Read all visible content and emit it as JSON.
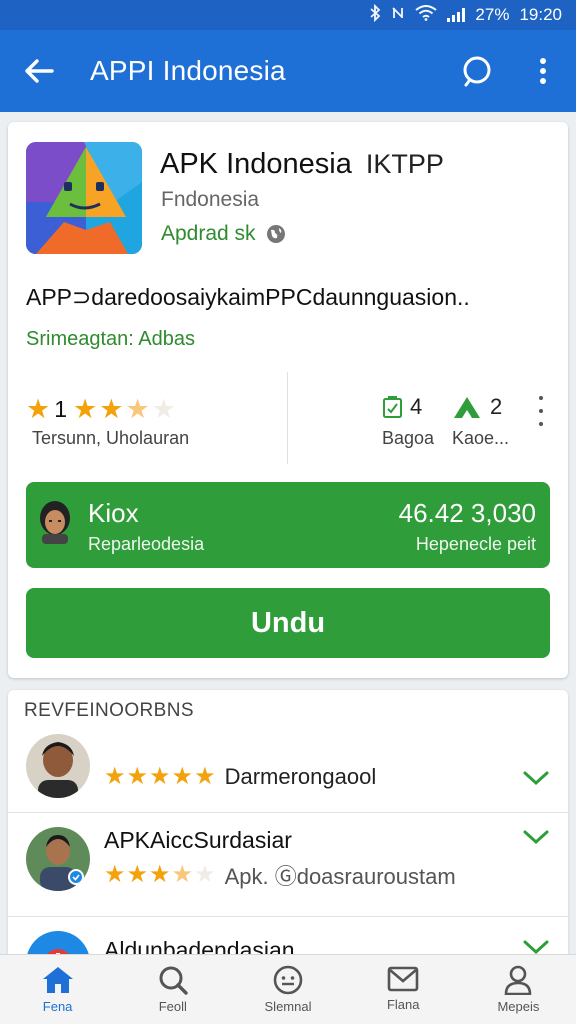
{
  "status_bar": {
    "battery": "27%",
    "time": "19:20"
  },
  "app_bar": {
    "title": "APPI Indonesia"
  },
  "app": {
    "name": "APK Indonesia",
    "name_tag": "IKTPP",
    "developer": "Fndonesia",
    "category": "Apdrad sk",
    "description": "APP⊃daredoosaiykaimPPCdaunnguasion..",
    "subtitle": "Srimeagtan: Adbas"
  },
  "stats": {
    "rating_value": "1",
    "rating_stars": 3.5,
    "rating_label": "Tersunn,  Uholauran",
    "stat1_value": "4",
    "stat1_label": "Bagoa",
    "stat2_value": "2",
    "stat2_label": "Kaoe...",
    "colors": {
      "star": "#f4a20c",
      "accent_green": "#2f9d3a",
      "brand_blue": "#1e6fd6"
    }
  },
  "promo": {
    "title": "Kiox",
    "subtitle": "Reparleodesia",
    "price": "46.42 3,030",
    "price_sub": "Hepenecle peit"
  },
  "install_label": "Undu",
  "reviews": {
    "heading": "REVFEINOORBNS",
    "items": [
      {
        "name": "",
        "stars": 5,
        "text": "Darmerongaool"
      },
      {
        "name": "APKAiccSurdasiar",
        "stars": 3.5,
        "text": "Apk. Ⓖdoasrauroustam"
      },
      {
        "name": "Aldunbadendasian",
        "stars": 0,
        "text": ""
      }
    ]
  },
  "bottom_nav": [
    {
      "icon": "home-icon",
      "label": "Fena"
    },
    {
      "icon": "search-icon",
      "label": "Feoll"
    },
    {
      "icon": "smiley-icon",
      "label": "Slemnal"
    },
    {
      "icon": "mail-icon",
      "label": "Flana"
    },
    {
      "icon": "person-icon",
      "label": "Mepeis"
    }
  ]
}
